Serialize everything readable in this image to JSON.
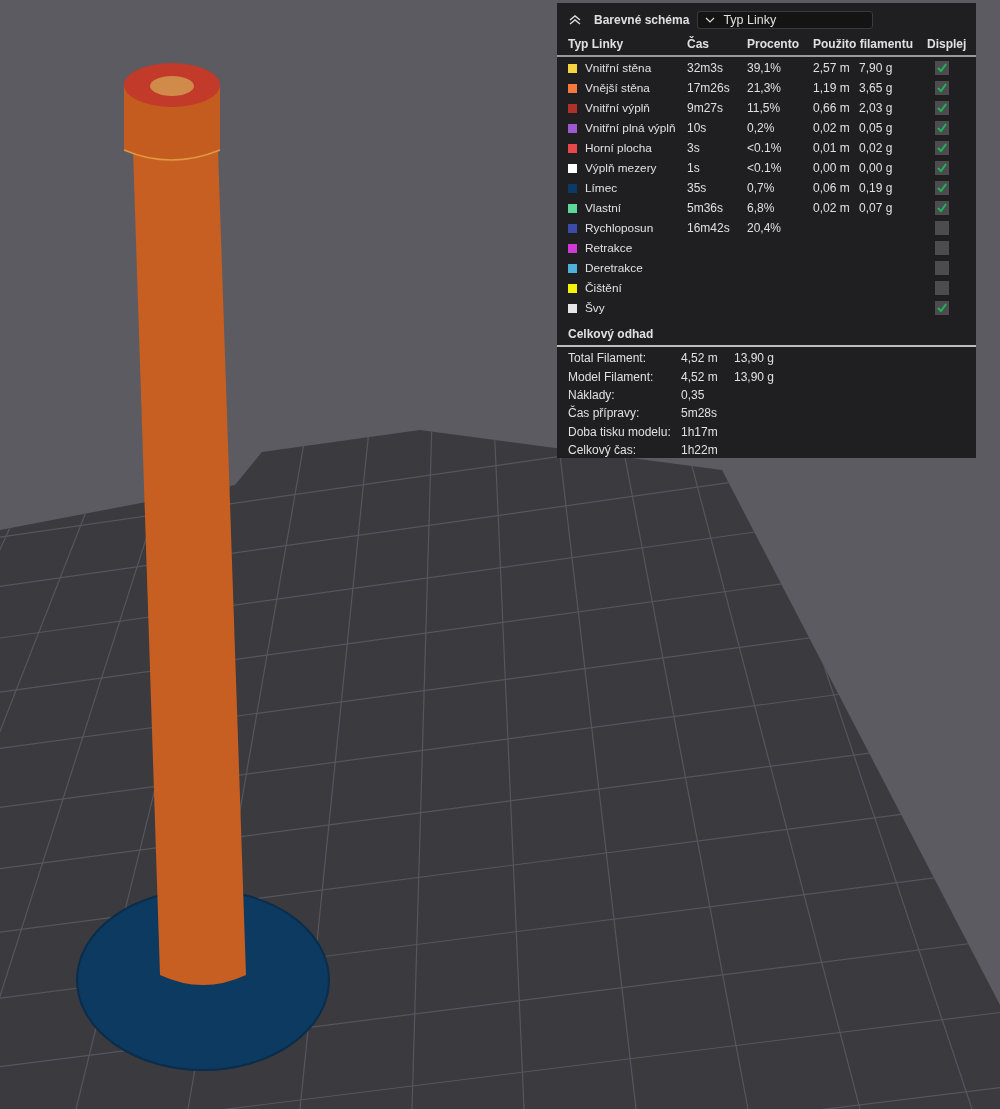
{
  "legend": {
    "title": "Barevné schéma",
    "dropdown": {
      "value": "Typ Linky"
    },
    "columns": [
      "Typ Linky",
      "Čas",
      "Procento",
      "Použito filamentu",
      "Displej"
    ],
    "rows": [
      {
        "name": "Vnitřní stěna",
        "color": "#f7d33f",
        "time": "32m3s",
        "percent": "39,1%",
        "length": "2,57 m",
        "weight": "7,90 g",
        "checked": true
      },
      {
        "name": "Vnější stěna",
        "color": "#f5793a",
        "time": "17m26s",
        "percent": "21,3%",
        "length": "1,19 m",
        "weight": "3,65 g",
        "checked": true
      },
      {
        "name": "Vnitřní výplň",
        "color": "#b0302a",
        "time": "9m27s",
        "percent": "11,5%",
        "length": "0,66 m",
        "weight": "2,03 g",
        "checked": true
      },
      {
        "name": "Vnitřní plná výplň",
        "color": "#9a5bd0",
        "time": "10s",
        "percent": "0,2%",
        "length": "0,02 m",
        "weight": "0,05 g",
        "checked": true
      },
      {
        "name": "Horní plocha",
        "color": "#e8484a",
        "time": "3s",
        "percent": "<0.1%",
        "length": "0,01 m",
        "weight": "0,02 g",
        "checked": true
      },
      {
        "name": "Výplň mezery",
        "color": "#ffffff",
        "time": "1s",
        "percent": "<0.1%",
        "length": "0,00 m",
        "weight": "0,00 g",
        "checked": true
      },
      {
        "name": "Límec",
        "color": "#0c3a66",
        "time": "35s",
        "percent": "0,7%",
        "length": "0,06 m",
        "weight": "0,19 g",
        "checked": true
      },
      {
        "name": "Vlastní",
        "color": "#5ed79a",
        "time": "5m36s",
        "percent": "6,8%",
        "length": "0,02 m",
        "weight": "0,07 g",
        "checked": true
      },
      {
        "name": "Rychloposun",
        "color": "#3c4aa8",
        "time": "16m42s",
        "percent": "20,4%",
        "checked": false
      },
      {
        "name": "Retrakce",
        "color": "#d03ad4",
        "checked": false
      },
      {
        "name": "Deretrakce",
        "color": "#4fb0de",
        "checked": false
      },
      {
        "name": "Čištění",
        "color": "#f2f20a",
        "checked": false
      },
      {
        "name": "Švy",
        "color": "#e6e6e6",
        "checked": true
      }
    ]
  },
  "summary": {
    "title": "Celkový odhad",
    "rows": [
      {
        "label": "Total Filament:",
        "values": [
          "4,52 m",
          "13,90 g"
        ]
      },
      {
        "label": "Model Filament:",
        "values": [
          "4,52 m",
          "13,90 g"
        ]
      },
      {
        "label": "Náklady:",
        "values": [
          "0,35"
        ]
      },
      {
        "label": "Čas přípravy:",
        "values": [
          "5m28s"
        ]
      },
      {
        "label": "Doba tisku modelu:",
        "values": [
          "1h17m"
        ]
      },
      {
        "label": "Celkový čas:",
        "values": [
          "1h22m"
        ]
      }
    ]
  }
}
